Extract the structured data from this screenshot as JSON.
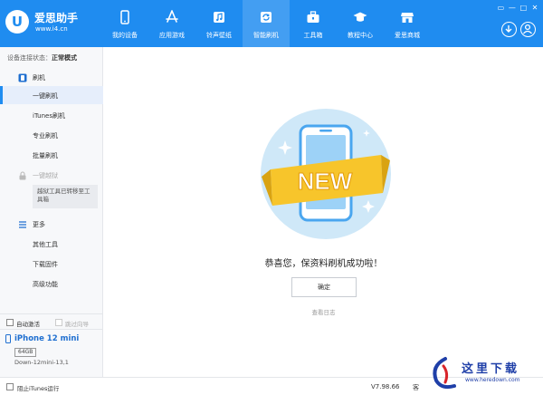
{
  "app": {
    "logo_mark": "U",
    "name": "爱思助手",
    "url": "www.i4.cn"
  },
  "nav": [
    {
      "label": "我的设备",
      "icon": "phone-icon"
    },
    {
      "label": "应用游戏",
      "icon": "app-store-icon"
    },
    {
      "label": "铃声壁纸",
      "icon": "music-icon"
    },
    {
      "label": "智能刷机",
      "icon": "refresh-icon",
      "active": true
    },
    {
      "label": "工具箱",
      "icon": "toolbox-icon"
    },
    {
      "label": "教程中心",
      "icon": "graduation-cap-icon"
    },
    {
      "label": "爱思商城",
      "icon": "store-icon"
    }
  ],
  "window": {
    "minimize": "▭",
    "restore": "—",
    "maximize": "□",
    "close": "✕"
  },
  "sidebar": {
    "status_label": "设备连接状态：",
    "status_value": "正常模式",
    "flash_section": "刷机",
    "items_flash": [
      "一键刷机",
      "iTunes刷机",
      "专业刷机",
      "批量刷机"
    ],
    "jailbreak_section": "一键越狱",
    "jailbreak_note": "越狱工具已转移至工具箱",
    "more_section": "更多",
    "items_more": [
      "其他工具",
      "下载固件",
      "高级功能"
    ],
    "auto_activate": "自动激活",
    "skip_guide": "跳过向导"
  },
  "device": {
    "name": "iPhone 12 mini",
    "storage": "64GB",
    "model": "Down-12mini-13,1"
  },
  "main": {
    "badge_text": "NEW",
    "success_message": "恭喜您，保资料刷机成功啦！",
    "ok_button": "确定",
    "log_link": "查看日志"
  },
  "footer": {
    "block_itunes": "阻止iTunes运行",
    "version": "V7.98.66",
    "feedback": "客"
  },
  "watermark": {
    "title": "这里下载",
    "url": "www.heredown.com"
  },
  "colors": {
    "brand_blue": "#1f8cf0",
    "ribbon_yellow": "#f7c52b",
    "hero_circle": "#cfe8f8"
  }
}
